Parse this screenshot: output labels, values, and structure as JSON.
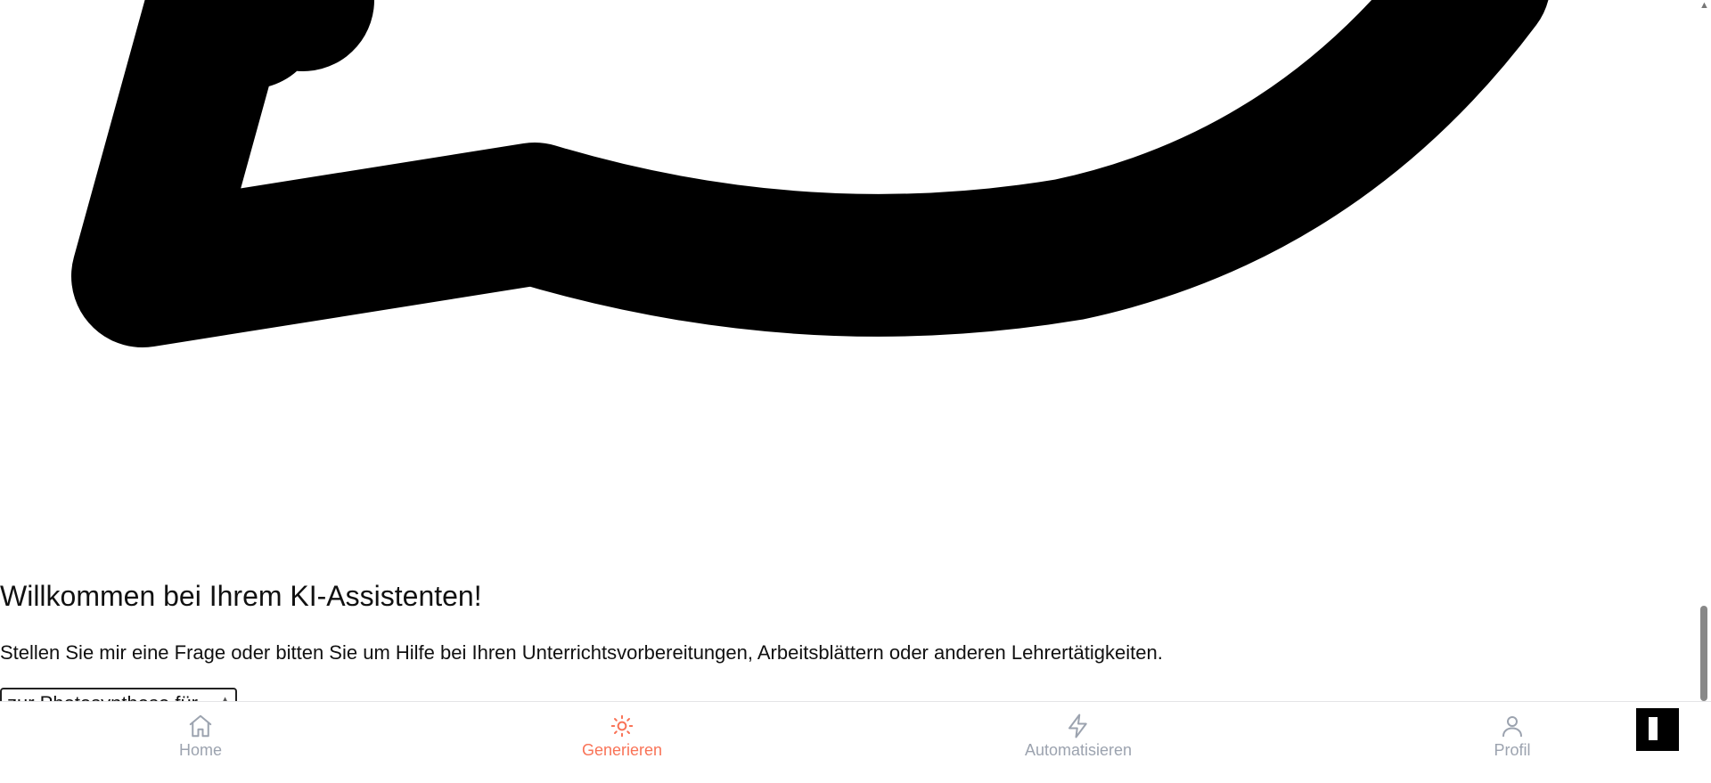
{
  "welcome": {
    "title": "Willkommen bei Ihrem KI-Assistenten!",
    "subtitle": "Stellen Sie mir eine Frage oder bitten Sie um Hilfe bei Ihren Unterrichtsvorbereitungen, Arbeitsblättern oder anderen Lehrertätigkeiten."
  },
  "suggestion": {
    "text": "zur Photosynthese für"
  },
  "icons": {
    "chat_bubble": "message-circle-icon",
    "home": "home-icon",
    "generate": "sun-icon",
    "automate": "zap-icon",
    "profile": "user-icon",
    "fab": "sidebar-toggle-icon"
  },
  "nav": {
    "items": [
      {
        "label": "Home",
        "icon": "home-icon",
        "active": false
      },
      {
        "label": "Generieren",
        "icon": "sun-icon",
        "active": true
      },
      {
        "label": "Automatisieren",
        "icon": "zap-icon",
        "active": false
      },
      {
        "label": "Profil",
        "icon": "user-icon",
        "active": false
      }
    ]
  },
  "colors": {
    "accent": "#f97357",
    "inactive": "#9ca3af",
    "text": "#111111",
    "icon_stroke": "#000000"
  }
}
